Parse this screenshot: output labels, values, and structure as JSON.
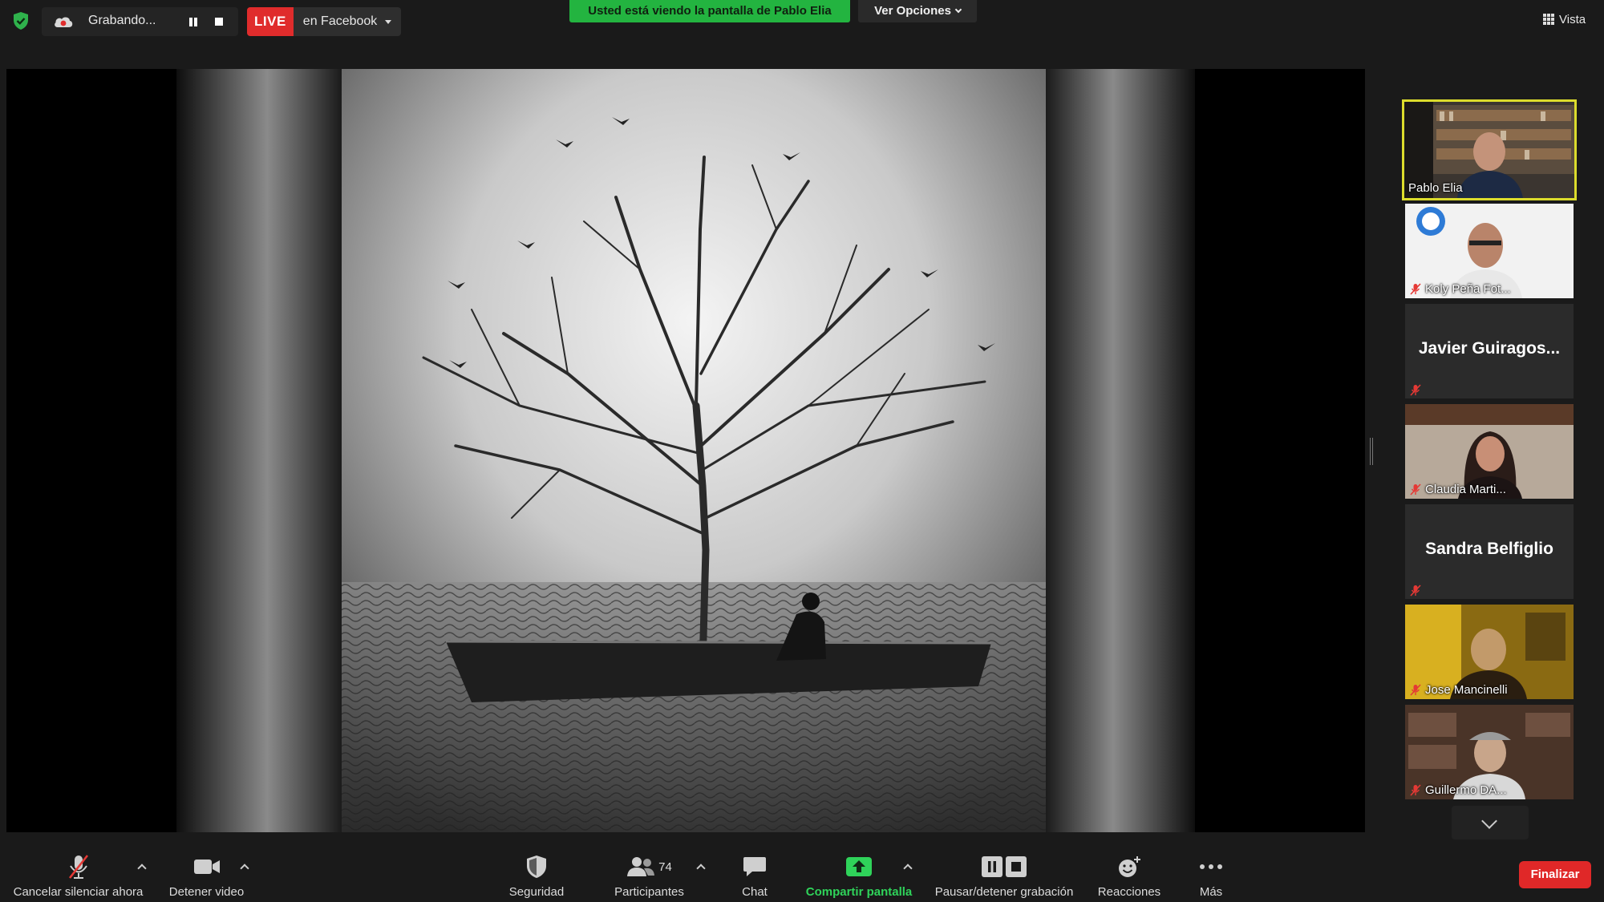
{
  "app": {
    "recording_label": "Grabando...",
    "live_badge": "LIVE",
    "live_destination": "en Facebook",
    "share_banner": "Usted está viendo la pantalla de Pablo Elia",
    "view_options": "Ver Opciones",
    "view_label": "Vista"
  },
  "icons": {
    "security_status": "shield-check-icon",
    "recording": "cloud-record-icon",
    "view": "grid-icon"
  },
  "colors": {
    "live_red": "#e02c2c",
    "share_green": "#23b440",
    "active_speaker_border": "#dcdc2c",
    "end_button": "#e02828"
  },
  "participants": {
    "tiles": [
      {
        "name": "Pablo Elia",
        "active": true,
        "video": true,
        "muted": false
      },
      {
        "name": "Koly Peña Fot...",
        "active": false,
        "video": true,
        "muted": true
      },
      {
        "name": "Javier  Guiragos...",
        "active": false,
        "video": false,
        "muted": true
      },
      {
        "name": "Claudia Marti...",
        "active": false,
        "video": true,
        "muted": true
      },
      {
        "name": "Sandra Belfiglio",
        "active": false,
        "video": false,
        "muted": true
      },
      {
        "name": "Jose Mancinelli",
        "active": false,
        "video": true,
        "muted": true
      },
      {
        "name": "Guillermo DA...",
        "active": false,
        "video": true,
        "muted": true
      }
    ]
  },
  "toolbar": {
    "unmute": "Cancelar silenciar ahora",
    "stop_video": "Detener video",
    "security": "Seguridad",
    "participants": "Participantes",
    "participants_count": "74",
    "chat": "Chat",
    "share_screen": "Compartir pantalla",
    "pause_stop_recording": "Pausar/detener grabación",
    "reactions": "Reacciones",
    "more": "Más",
    "end": "Finalizar"
  }
}
